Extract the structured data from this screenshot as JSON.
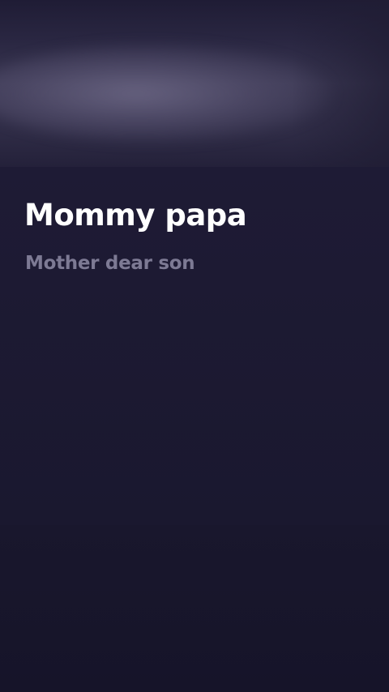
{
  "cover": {
    "artwork": "blurred-cover-art"
  },
  "track": {
    "title": "Mommy papa",
    "subtitle": "Mother dear son"
  },
  "colors": {
    "background": "#1d1a33",
    "title": "#ffffff",
    "subtitle": "#7d7a94"
  }
}
